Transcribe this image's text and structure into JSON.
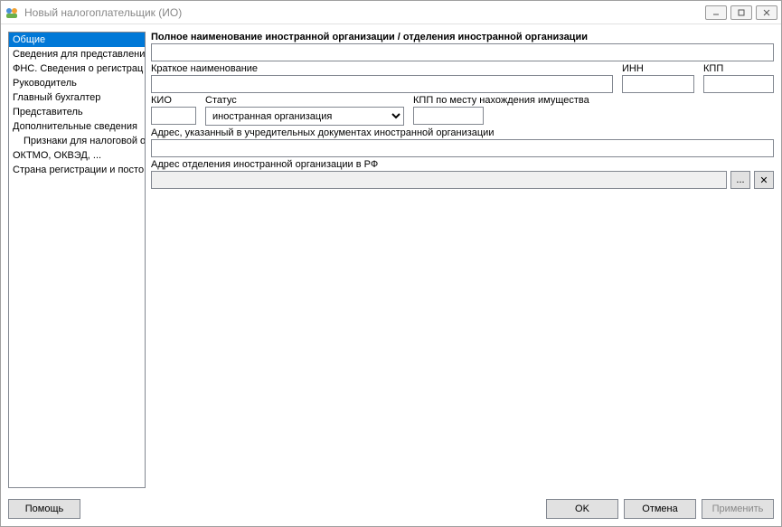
{
  "window": {
    "title": "Новый налогоплательщик (ИО)"
  },
  "sidebar": {
    "items": [
      {
        "label": "Общие",
        "selected": true
      },
      {
        "label": "Сведения для представлени"
      },
      {
        "label": "ФНС. Сведения о регистрац"
      },
      {
        "label": "Руководитель"
      },
      {
        "label": "Главный бухгалтер"
      },
      {
        "label": "Представитель"
      },
      {
        "label": "Дополнительные сведения"
      },
      {
        "label": "Признаки для налоговой о",
        "indent": true
      },
      {
        "label": "ОКТМО, ОКВЭД, ..."
      },
      {
        "label": "Страна регистрации и посто"
      }
    ]
  },
  "form": {
    "full_name_label": "Полное наименование иностранной организации / отделения иностранной организации",
    "full_name_value": "",
    "short_name_label": "Краткое наименование",
    "short_name_value": "",
    "inn_label": "ИНН",
    "inn_value": "",
    "kpp_label": "КПП",
    "kpp_value": "",
    "kio_label": "КИО",
    "kio_value": "",
    "status_label": "Статус",
    "status_value": "иностранная организация",
    "kpp_property_label": "КПП по месту нахождения имущества",
    "kpp_property_value": "",
    "address_docs_label": "Адрес, указанный в учредительных документах иностранной организации",
    "address_docs_value": "",
    "address_rf_label": "Адрес отделения иностранной организации в РФ",
    "address_rf_value": "",
    "browse_btn": "...",
    "clear_btn": "✕"
  },
  "footer": {
    "help": "Помощь",
    "ok": "OK",
    "cancel": "Отмена",
    "apply": "Применить"
  }
}
